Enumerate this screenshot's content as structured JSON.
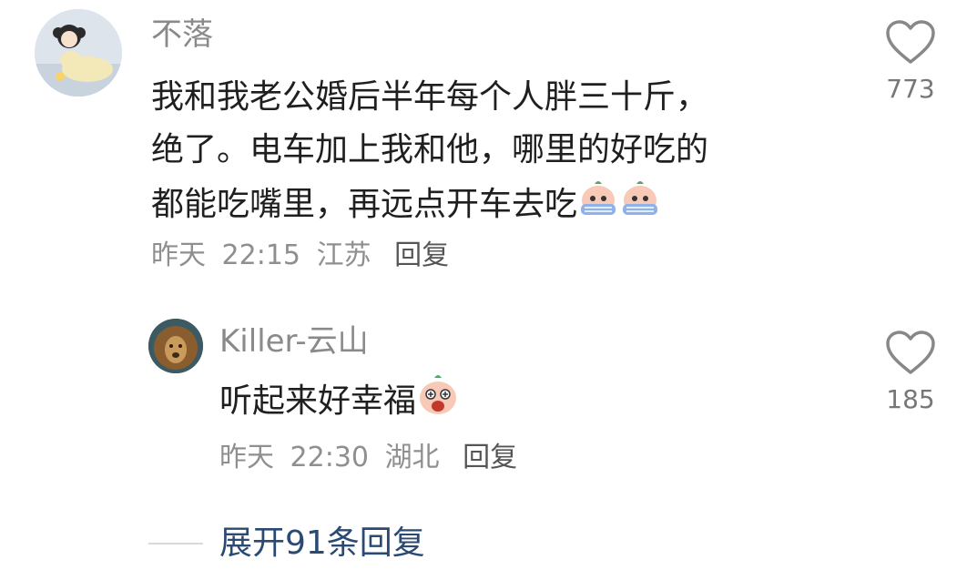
{
  "comment": {
    "username": "不落",
    "text_line1": "我和我老公婚后半年每个人胖三十斤，",
    "text_line2": "绝了。电车加上我和他，哪里的好吃的",
    "text_line3": "都能吃嘴里，再远点开车去吃",
    "day": "昨天",
    "time": "22:15",
    "location": "江苏",
    "reply_label": "回复",
    "like_count": "773"
  },
  "reply": {
    "username": "Killer-云山",
    "text": "听起来好幸福",
    "day": "昨天",
    "time": "22:30",
    "location": "湖北",
    "reply_label": "回复",
    "like_count": "185"
  },
  "expand": {
    "label": "展开91条回复"
  }
}
